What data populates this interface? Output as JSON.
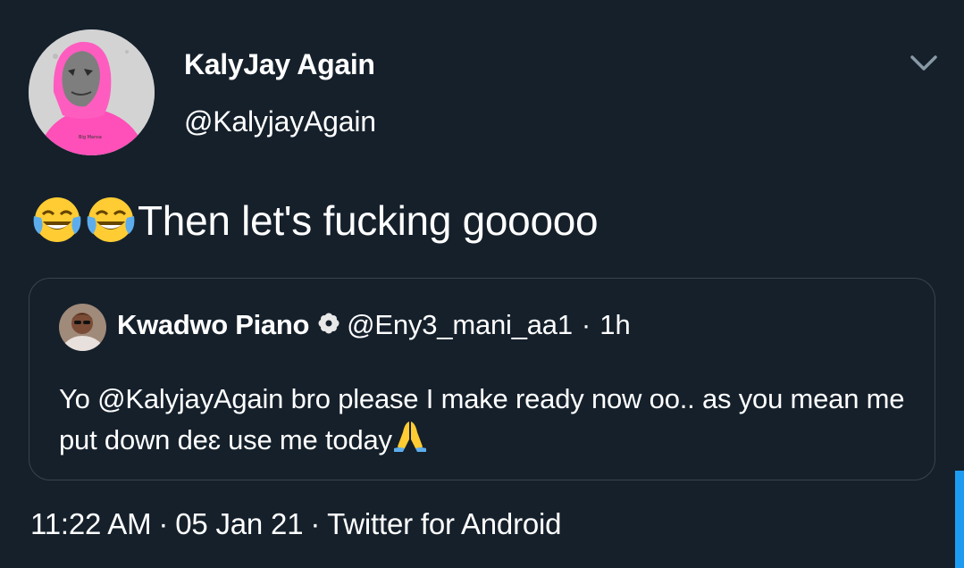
{
  "author": {
    "display_name": "KalyJay Again",
    "handle": "@KalyjayAgain"
  },
  "tweet": {
    "emoji_1": "face-with-tears-of-joy",
    "emoji_2": "face-with-tears-of-joy",
    "text": "Then let's fucking gooooo"
  },
  "quoted_tweet": {
    "display_name": "Kwadwo Piano",
    "badge_icon": "flower-badge-icon",
    "handle": "@Eny3_mani_aa1",
    "dot": "·",
    "time": "1h",
    "text": "Yo @KalyjayAgain bro please I make ready now oo.. as you mean me put down deɛ use me today",
    "trailing_emoji": "folded-hands"
  },
  "meta": {
    "time": "11:22 AM",
    "sep1": "·",
    "date": "05 Jan 21",
    "sep2": "·",
    "source": "Twitter for Android"
  },
  "colors": {
    "background": "#15202b",
    "text": "#ffffff",
    "border": "#38444d",
    "accent": "#1d9bf0",
    "hoodie": "#ff4fb8"
  }
}
